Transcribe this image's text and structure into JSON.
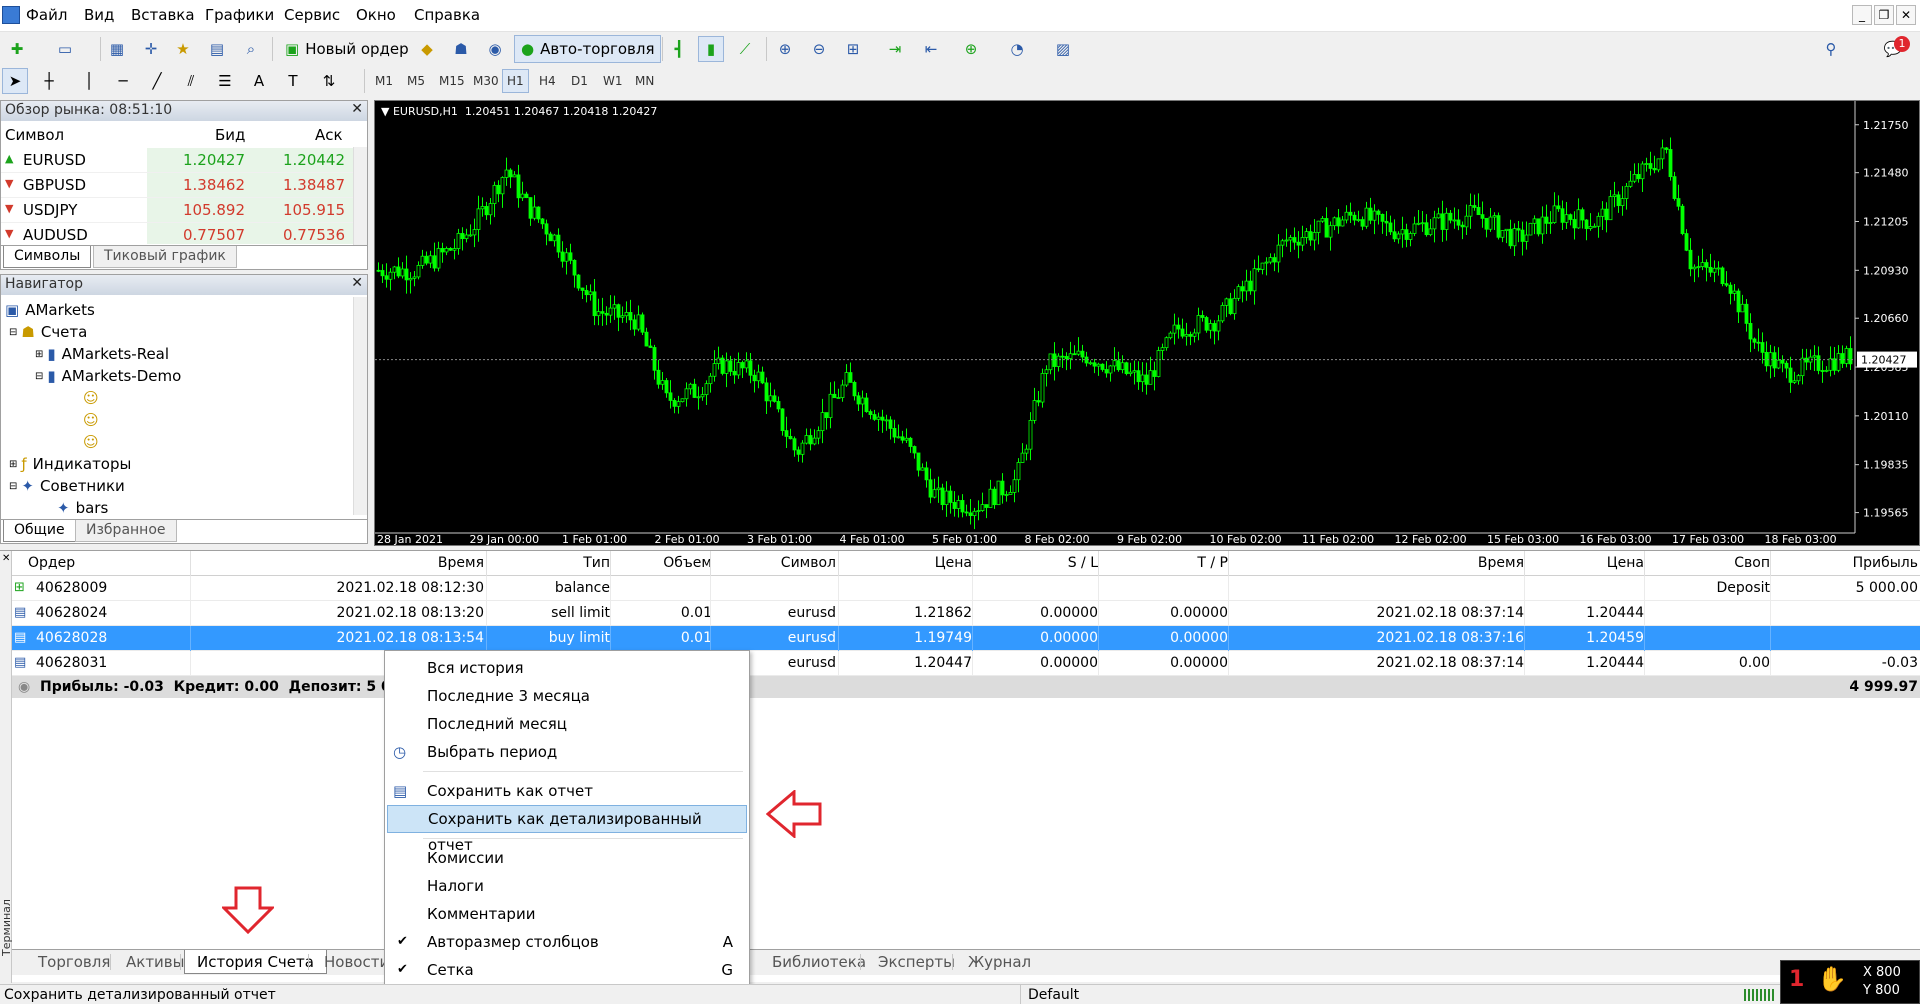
{
  "menu": [
    "Файл",
    "Вид",
    "Вставка",
    "Графики",
    "Сервис",
    "Окно",
    "Справка"
  ],
  "toolbar": {
    "new_order": "Новый ордер",
    "auto_trading": "Авто-торговля"
  },
  "timeframes": [
    "M1",
    "M5",
    "M15",
    "M30",
    "H1",
    "H4",
    "D1",
    "W1",
    "MN"
  ],
  "active_timeframe": "H1",
  "notification_badge": "1",
  "market_watch": {
    "title": "Обзор рынка: 08:51:10",
    "columns": {
      "symbol": "Символ",
      "bid": "Бид",
      "ask": "Аск"
    },
    "rows": [
      {
        "symbol": "EURUSD",
        "bid": "1.20427",
        "ask": "1.20442",
        "dir": "up"
      },
      {
        "symbol": "GBPUSD",
        "bid": "1.38462",
        "ask": "1.38487",
        "dir": "down"
      },
      {
        "symbol": "USDJPY",
        "bid": "105.892",
        "ask": "105.915",
        "dir": "down"
      },
      {
        "symbol": "AUDUSD",
        "bid": "0.77507",
        "ask": "0.77536",
        "dir": "down"
      }
    ],
    "tabs": [
      "Символы",
      "Тиковый график"
    ]
  },
  "navigator": {
    "title": "Навигатор",
    "items": [
      "AMarkets",
      "Счета",
      "AMarkets-Real",
      "AMarkets-Demo",
      "Индикаторы",
      "Советники",
      "bars"
    ],
    "tabs": [
      "Общие",
      "Избранное"
    ]
  },
  "chart": {
    "header": "EURUSD,H1  1.20451 1.20467 1.20418 1.20427",
    "current_price": "1.20427",
    "price_labels": [
      "1.21750",
      "1.21480",
      "1.21205",
      "1.20930",
      "1.20660",
      "1.20385",
      "1.20110",
      "1.19835",
      "1.19565"
    ],
    "time_labels": [
      "28 Jan 2021",
      "29 Jan 00:00",
      "1 Feb 01:00",
      "2 Feb 01:00",
      "3 Feb 01:00",
      "4 Feb 01:00",
      "5 Feb 01:00",
      "8 Feb 02:00",
      "9 Feb 02:00",
      "10 Feb 02:00",
      "11 Feb 02:00",
      "12 Feb 02:00",
      "15 Feb 03:00",
      "16 Feb 03:00",
      "17 Feb 03:00",
      "18 Feb 03:00"
    ]
  },
  "history": {
    "columns": [
      "Ордер",
      "Время",
      "Тип",
      "Объем",
      "Символ",
      "Цена",
      "S / L",
      "T / P",
      "Время",
      "Цена",
      "Своп",
      "Прибыль"
    ],
    "rows": [
      {
        "order": "40628009",
        "time": "2021.02.18 08:12:30",
        "type": "balance",
        "volume": "",
        "symbol": "",
        "price": "",
        "sl": "",
        "tp": "",
        "ctime": "",
        "cprice": "",
        "swap": "Deposit",
        "profit": "5 000.00"
      },
      {
        "order": "40628024",
        "time": "2021.02.18 08:13:20",
        "type": "sell limit",
        "volume": "0.01",
        "symbol": "eurusd",
        "price": "1.21862",
        "sl": "0.00000",
        "tp": "0.00000",
        "ctime": "2021.02.18 08:37:14",
        "cprice": "1.20444",
        "swap": "",
        "profit": ""
      },
      {
        "order": "40628028",
        "time": "2021.02.18 08:13:54",
        "type": "buy limit",
        "volume": "0.01",
        "symbol": "eurusd",
        "price": "1.19749",
        "sl": "0.00000",
        "tp": "0.00000",
        "ctime": "2021.02.18 08:37:16",
        "cprice": "1.20459",
        "swap": "",
        "profit": ""
      },
      {
        "order": "40628031",
        "time": "2021.02",
        "type": "",
        "volume": "",
        "symbol": "eurusd",
        "price": "1.20447",
        "sl": "0.00000",
        "tp": "0.00000",
        "ctime": "2021.02.18 08:37:14",
        "cprice": "1.20444",
        "swap": "0.00",
        "profit": "-0.03"
      }
    ],
    "summary": "Прибыль: -0.03  Кредит: 0.00  Депозит: 5 000.0",
    "summary_total": "4 999.97"
  },
  "context_menu": {
    "items": [
      {
        "label": "Вся история"
      },
      {
        "label": "Последние 3 месяца"
      },
      {
        "label": "Последний месяц"
      },
      {
        "label": "Выбрать период",
        "icon": "clock-icon"
      },
      {
        "sep": true
      },
      {
        "label": "Сохранить как отчет",
        "icon": "report-icon"
      },
      {
        "label": "Сохранить как детализированный отчет",
        "hl": true
      },
      {
        "sep": true
      },
      {
        "label": "Комиссии"
      },
      {
        "label": "Налоги"
      },
      {
        "label": "Комментарии"
      },
      {
        "label": "Авторазмер столбцов",
        "check": true,
        "short": "A"
      },
      {
        "label": "Сетка",
        "check": true,
        "short": "G"
      }
    ]
  },
  "terminal_tabs": [
    "Торговля",
    "Активы",
    "История Счета",
    "Новости",
    "Библиотека",
    "Эксперты",
    "Журнал"
  ],
  "terminal_label": "Терминал",
  "status": {
    "left": "Сохранить детализированный отчет",
    "profile": "Default",
    "x": "X 800",
    "y": "Y 800"
  },
  "colors": {
    "up": "#1ca31c",
    "down": "#d23a2c",
    "chart_bg": "#000000",
    "candle": "#00ff00",
    "selected": "#3399ff",
    "arrow": "#e0262e"
  }
}
